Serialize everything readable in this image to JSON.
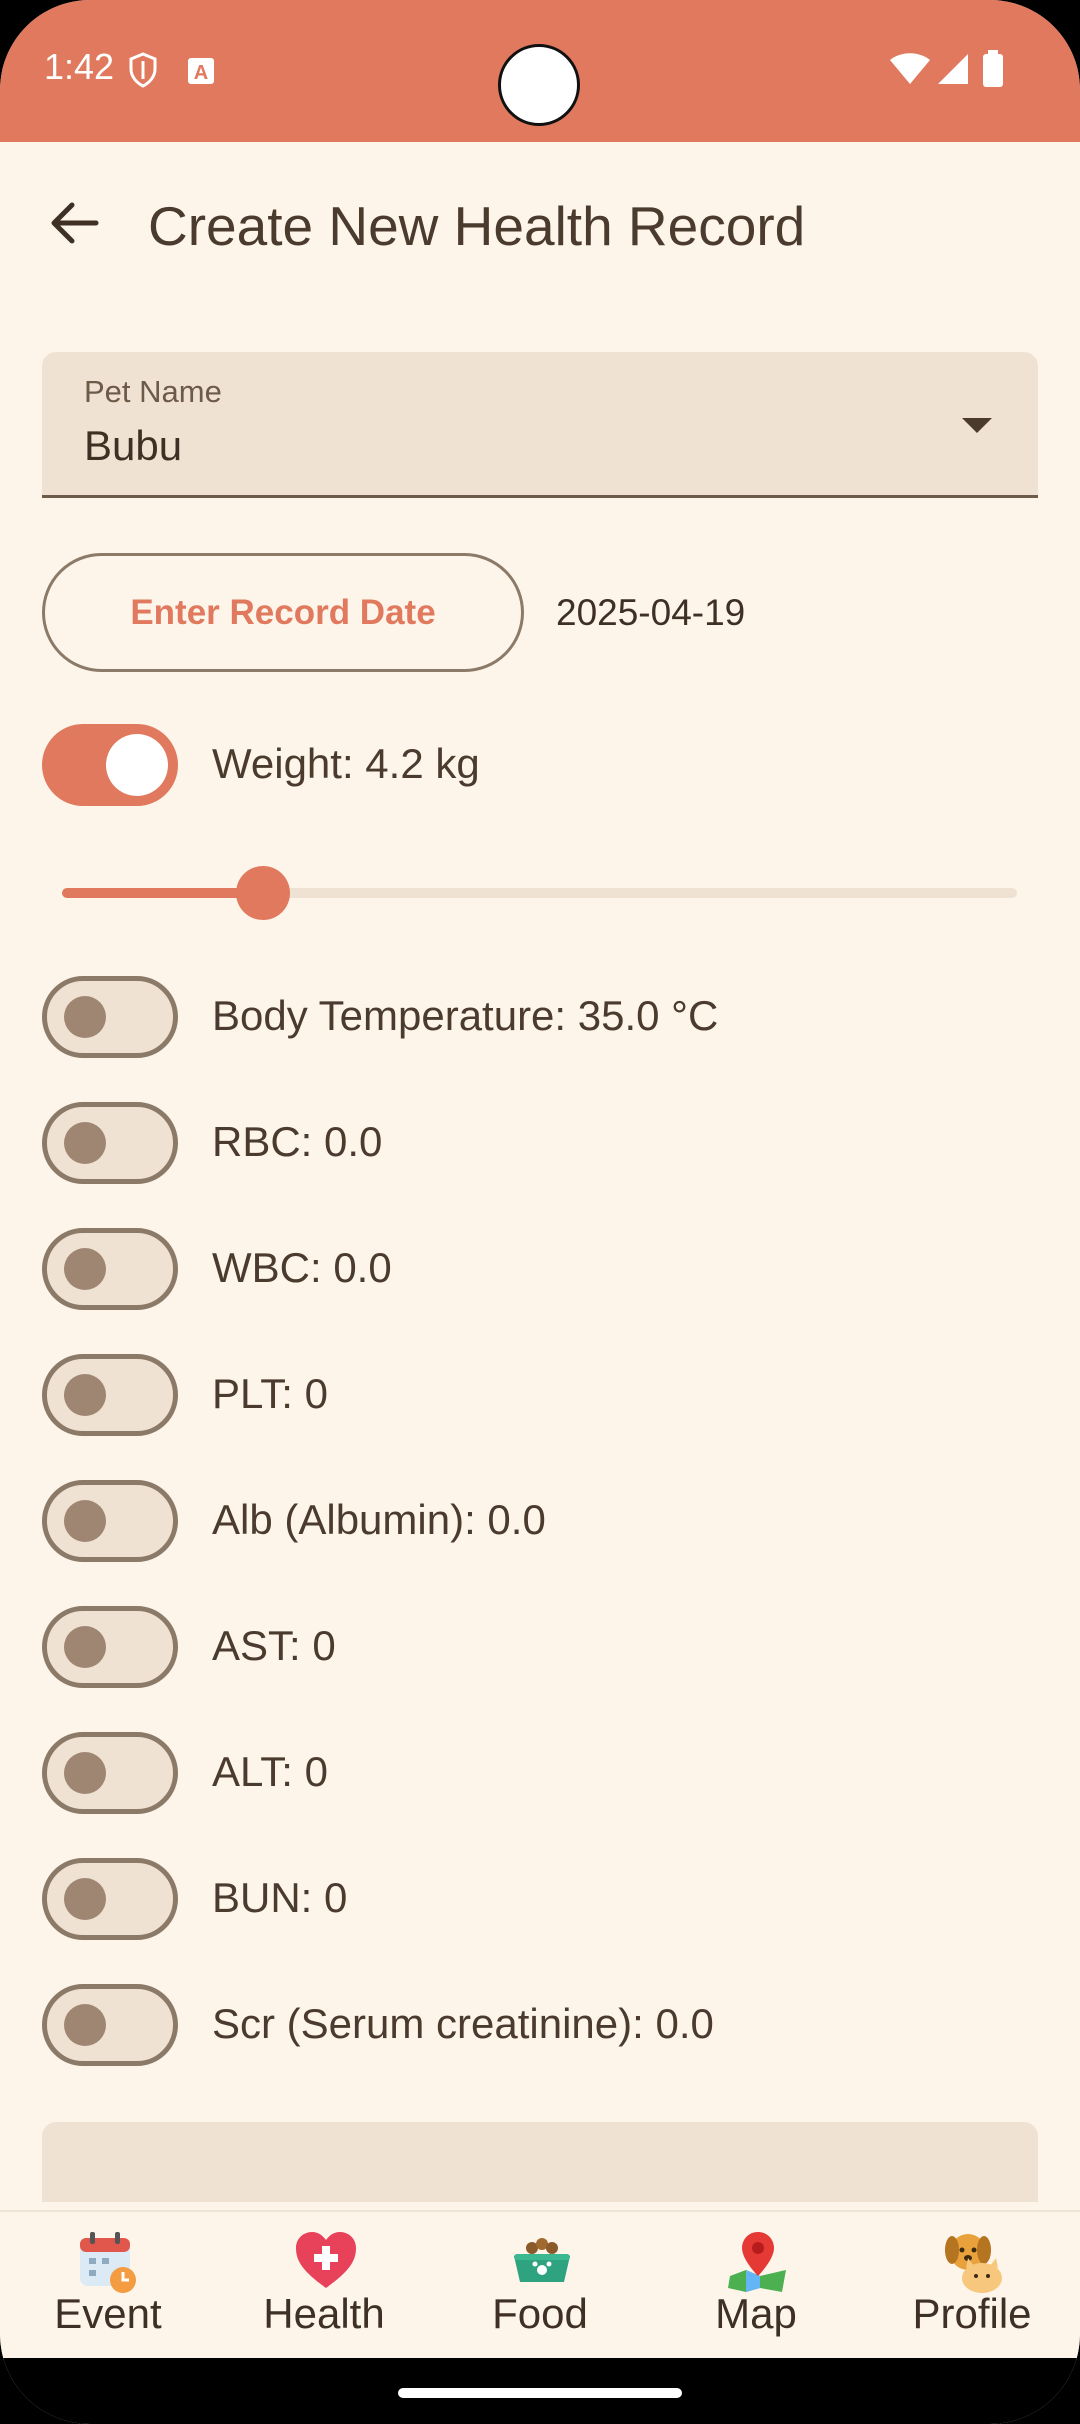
{
  "status_bar": {
    "time": "1:42",
    "icons": [
      "shield-icon",
      "text-a-icon",
      "wifi-icon",
      "signal-icon",
      "battery-icon"
    ]
  },
  "app_bar": {
    "title": "Create New Health Record",
    "back_icon": "arrow-left-icon"
  },
  "pet_field": {
    "label": "Pet Name",
    "value": "Bubu"
  },
  "record_date": {
    "button_label": "Enter Record Date",
    "value": "2025-04-19"
  },
  "weight": {
    "label": "Weight: 4.2 kg",
    "enabled": true,
    "slider_fraction": 0.21
  },
  "metrics": [
    {
      "label": "Body Temperature: 35.0 °C",
      "enabled": false
    },
    {
      "label": "RBC: 0.0",
      "enabled": false
    },
    {
      "label": "WBC: 0.0",
      "enabled": false
    },
    {
      "label": "PLT: 0",
      "enabled": false
    },
    {
      "label": "Alb (Albumin): 0.0",
      "enabled": false
    },
    {
      "label": "AST: 0",
      "enabled": false
    },
    {
      "label": "ALT: 0",
      "enabled": false
    },
    {
      "label": "BUN: 0",
      "enabled": false
    },
    {
      "label": "Scr (Serum creatinine): 0.0",
      "enabled": false
    }
  ],
  "bottom_nav": [
    {
      "label": "Event",
      "icon": "calendar-clock-icon"
    },
    {
      "label": "Health",
      "icon": "heart-plus-icon"
    },
    {
      "label": "Food",
      "icon": "pet-food-bowl-icon"
    },
    {
      "label": "Map",
      "icon": "map-pin-icon"
    },
    {
      "label": "Profile",
      "icon": "dog-cat-icon"
    }
  ],
  "colors": {
    "accent": "#E0795E",
    "background": "#FDF5EA",
    "surface": "#F0E2D2",
    "text": "#4A3B2E"
  }
}
